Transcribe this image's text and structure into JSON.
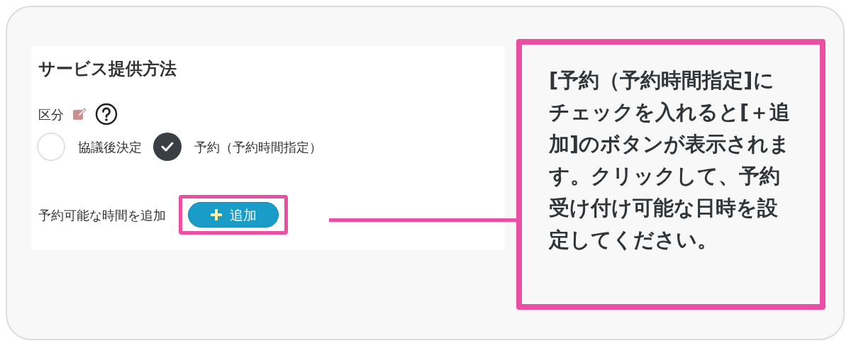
{
  "section_title": "サービス提供方法",
  "field_label": "区分",
  "options": [
    {
      "label": "協議後決定",
      "selected": false
    },
    {
      "label": "予約（予約時間指定）",
      "selected": true
    }
  ],
  "add_row": {
    "label": "予約可能な時間を追加",
    "button": "追加"
  },
  "callout": "[予約（予約時間指定]にチェックを入れると[＋追加]のボタンが表示されます。クリックして、予約受け付け可能な日時を設定してください。"
}
